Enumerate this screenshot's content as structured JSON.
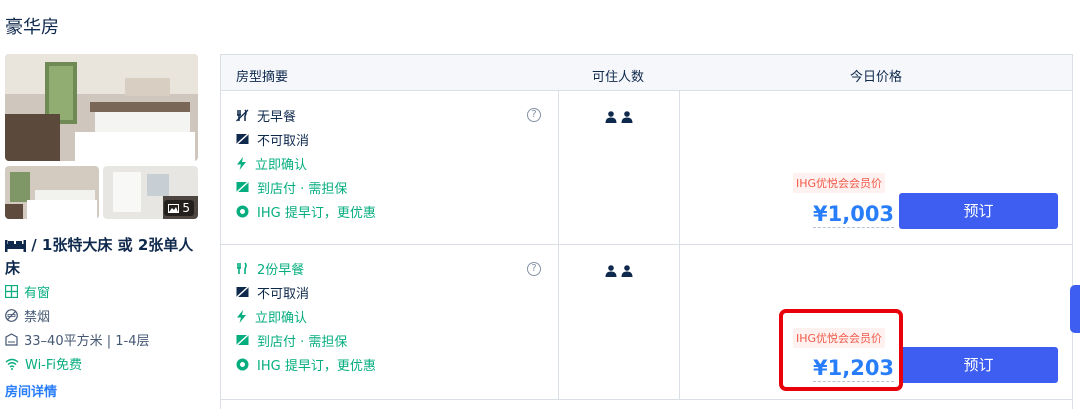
{
  "room": {
    "title": "豪华房",
    "photo_count": "5",
    "bed": "/ 1张特大床 或 2张单人床",
    "features": [
      {
        "icon": "window-icon",
        "label": "有窗",
        "tone": "green"
      },
      {
        "icon": "no-smoking-icon",
        "label": "禁烟",
        "tone": "grey"
      },
      {
        "icon": "area-icon",
        "label": "33–40平方米 | 1-4层",
        "tone": "grey"
      },
      {
        "icon": "wifi-icon",
        "label": "Wi-Fi免费",
        "tone": "green"
      }
    ],
    "details_link": "房间详情"
  },
  "table": {
    "headers": {
      "summary": "房型摘要",
      "guests": "可住人数",
      "price": "今日价格"
    },
    "rows": [
      {
        "policies": [
          {
            "icon": "no-meal-icon",
            "label": "无早餐",
            "tone": "dark"
          },
          {
            "icon": "no-cancel-icon",
            "label": "不可取消",
            "tone": "dark"
          },
          {
            "icon": "lightning-icon",
            "label": "立即确认",
            "tone": "green"
          },
          {
            "icon": "pay-at-hotel-icon",
            "label": "到店付 · 需担保",
            "tone": "green"
          },
          {
            "icon": "circle-dot-icon",
            "label": "IHG 提早订，更优惠",
            "tone": "green"
          }
        ],
        "help": "?",
        "guests": 2,
        "badge": "IHG优悦会会员价",
        "price": "¥1,003",
        "book_label": "预订"
      },
      {
        "policies": [
          {
            "icon": "meal-icon",
            "label": "2份早餐",
            "tone": "green"
          },
          {
            "icon": "no-cancel-icon",
            "label": "不可取消",
            "tone": "dark"
          },
          {
            "icon": "lightning-icon",
            "label": "立即确认",
            "tone": "green"
          },
          {
            "icon": "pay-at-hotel-icon",
            "label": "到店付 · 需担保",
            "tone": "green"
          },
          {
            "icon": "circle-dot-icon",
            "label": "IHG 提早订，更优惠",
            "tone": "green"
          }
        ],
        "help": "?",
        "guests": 2,
        "badge": "IHG优悦会会员价",
        "price": "¥1,203",
        "book_label": "预订"
      }
    ]
  },
  "colors": {
    "accent": "#3d5ef0",
    "price": "#287dfa",
    "green": "#06ae7f",
    "badge": "#f05a4a",
    "highlight": "#e8000b"
  }
}
